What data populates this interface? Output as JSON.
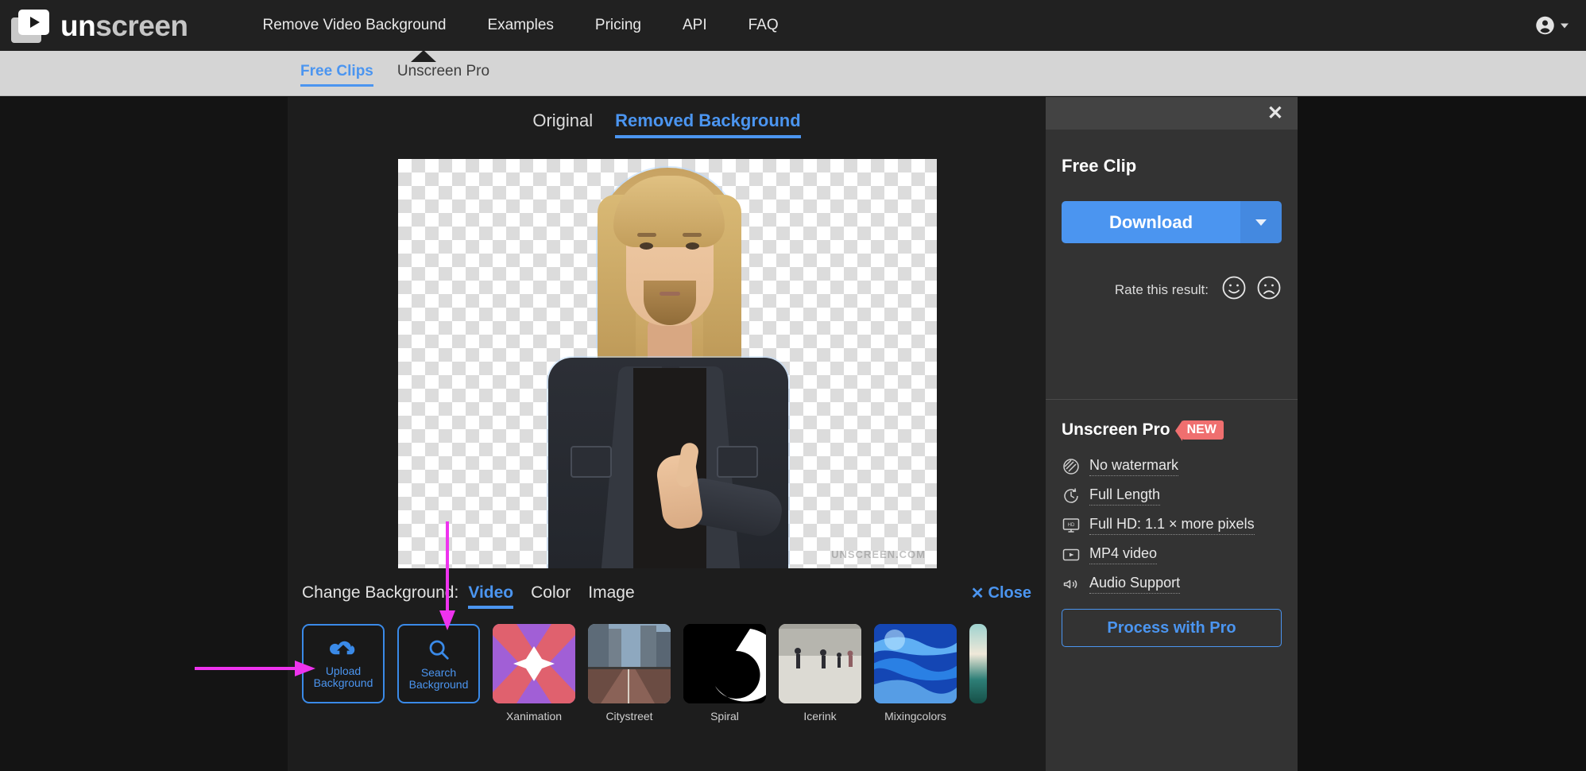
{
  "brand": {
    "name_part1": "un",
    "name_part2": "screen",
    "logo_icon": "video-play-icon"
  },
  "topnav": {
    "links": [
      {
        "label": "Remove Video Background"
      },
      {
        "label": "Examples"
      },
      {
        "label": "Pricing"
      },
      {
        "label": "API"
      },
      {
        "label": "FAQ"
      }
    ],
    "account": {
      "icon": "account-circle-icon",
      "caret": "chevron-down-icon"
    }
  },
  "subnav": {
    "tabs": [
      {
        "label": "Free Clips",
        "active": true
      },
      {
        "label": "Unscreen Pro",
        "active": false
      }
    ]
  },
  "viewer": {
    "tabs": [
      {
        "label": "Original",
        "active": false
      },
      {
        "label": "Removed Background",
        "active": true
      }
    ],
    "watermark": "UNSCREEN.COM"
  },
  "change_background": {
    "label": "Change Background:",
    "tabs": [
      {
        "label": "Video",
        "active": true
      },
      {
        "label": "Color",
        "active": false
      },
      {
        "label": "Image",
        "active": false
      }
    ],
    "close": {
      "label": "Close",
      "icon": "close-x-icon"
    },
    "thumbnails": [
      {
        "type": "action",
        "icon": "cloud-upload-icon",
        "line1": "Upload",
        "line2": "Background"
      },
      {
        "type": "action",
        "icon": "search-icon",
        "line1": "Search",
        "line2": "Background"
      },
      {
        "type": "video",
        "caption": "Xanimation"
      },
      {
        "type": "video",
        "caption": "Citystreet"
      },
      {
        "type": "video",
        "caption": "Spiral"
      },
      {
        "type": "video",
        "caption": "Icerink"
      },
      {
        "type": "video",
        "caption": "Mixingcolors"
      },
      {
        "type": "video",
        "caption": ""
      }
    ]
  },
  "right_panel": {
    "close_icon": "close-x-icon",
    "title": "Free Clip",
    "download": {
      "label": "Download",
      "caret_icon": "chevron-down-icon"
    },
    "rate": {
      "label": "Rate this result:",
      "positive_icon": "smiley-happy-icon",
      "negative_icon": "smiley-sad-icon"
    },
    "pro": {
      "title": "Unscreen Pro",
      "badge": "NEW",
      "features": [
        {
          "icon": "no-watermark-icon",
          "label": "No watermark"
        },
        {
          "icon": "clock-icon",
          "label": "Full Length"
        },
        {
          "icon": "hd-monitor-icon",
          "label": "Full HD: 1.1 × more pixels"
        },
        {
          "icon": "video-file-icon",
          "label": "MP4 video"
        },
        {
          "icon": "speaker-icon",
          "label": "Audio Support"
        }
      ],
      "cta": "Process with Pro"
    }
  },
  "annotations": {
    "color": "#ee33ee",
    "arrows": [
      {
        "name": "arrow-to-search-background",
        "direction": "down"
      },
      {
        "name": "arrow-to-upload-background",
        "direction": "right"
      }
    ]
  },
  "colors": {
    "accent_blue": "#4b95f0",
    "nav_dark": "#212121",
    "subnav_gray": "#d5d5d5",
    "panel_gray": "#333333",
    "badge_red": "#ef6f6f",
    "annotation_magenta": "#ee33ee"
  }
}
